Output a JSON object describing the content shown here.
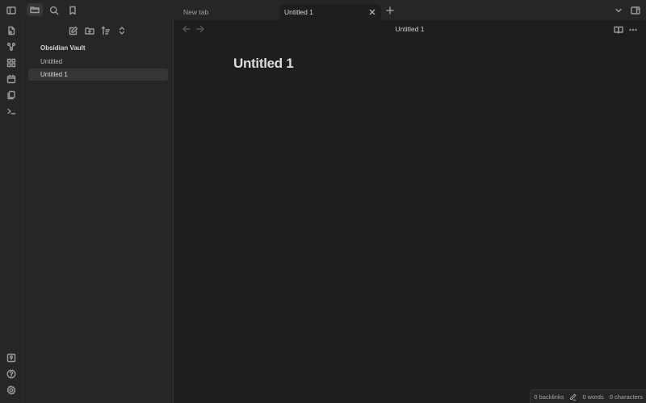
{
  "topbar": {
    "tabs": [
      {
        "label": "New tab",
        "active": false
      },
      {
        "label": "Untitled 1",
        "active": true
      }
    ],
    "icons": [
      "sidebar-toggle-icon",
      "folder-icon",
      "search-icon",
      "bookmark-icon",
      "plus-icon",
      "chevron-down-icon",
      "right-sidebar-toggle-icon"
    ]
  },
  "ribbon": {
    "top_icons": [
      "open-quick-switcher-icon",
      "graph-view-icon",
      "canvas-icon",
      "daily-note-icon",
      "templates-icon",
      "command-palette-icon"
    ],
    "bottom_icons": [
      "vault-switcher-icon",
      "help-icon",
      "settings-icon"
    ]
  },
  "sidebar": {
    "nav_actions": [
      "new-note-icon",
      "new-folder-icon",
      "sort-icon",
      "collapse-all-icon"
    ],
    "vault_name": "Obsidian Vault",
    "files": [
      {
        "label": "Untitled",
        "active": false
      },
      {
        "label": "Untitled 1",
        "active": true
      }
    ]
  },
  "main": {
    "header_title": "Untitled 1",
    "note_title": "Untitled 1"
  },
  "statusbar": {
    "backlinks": "0 backlinks",
    "words": "0 words",
    "characters": "0 characters"
  }
}
